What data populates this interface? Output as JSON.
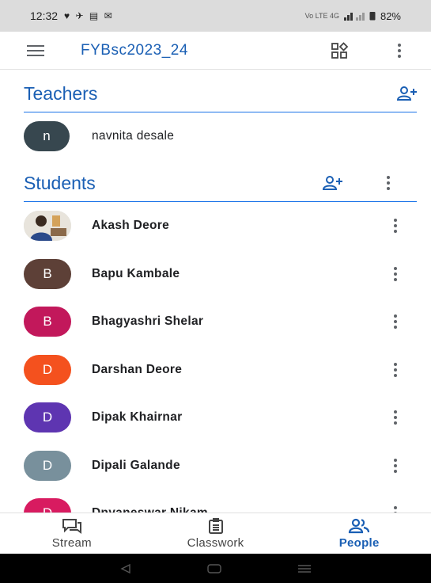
{
  "status_bar": {
    "time": "12:32",
    "notification_icons": "♥ ✈ ▤ ✉",
    "network_text": "Vo LTE 4G",
    "battery_percent": "82%"
  },
  "app_bar": {
    "class_name": "FYBsc2023_24"
  },
  "teachers": {
    "title": "Teachers",
    "people": [
      {
        "initial": "n",
        "name": "navnita desale",
        "color": "#37474f"
      }
    ]
  },
  "students": {
    "title": "Students",
    "people": [
      {
        "initial": "",
        "name": "Akash Deore",
        "color": "#9e9e9e",
        "photo": true
      },
      {
        "initial": "B",
        "name": "Bapu Kambale",
        "color": "#5d4037"
      },
      {
        "initial": "B",
        "name": "Bhagyashri Shelar",
        "color": "#c2185b"
      },
      {
        "initial": "D",
        "name": "Darshan Deore",
        "color": "#f4511e"
      },
      {
        "initial": "D",
        "name": "Dipak Khairnar",
        "color": "#5e35b1"
      },
      {
        "initial": "D",
        "name": "Dipali Galande",
        "color": "#78909c"
      },
      {
        "initial": "D",
        "name": "Dnyaneswar Nikam",
        "color": "#d81b60"
      }
    ]
  },
  "bottom_nav": {
    "items": [
      {
        "label": "Stream",
        "icon": "stream-icon"
      },
      {
        "label": "Classwork",
        "icon": "classwork-icon"
      },
      {
        "label": "People",
        "icon": "people-icon",
        "active": true
      }
    ]
  },
  "colors": {
    "accent": "#1a5fb4",
    "divider": "#1a73e8"
  }
}
